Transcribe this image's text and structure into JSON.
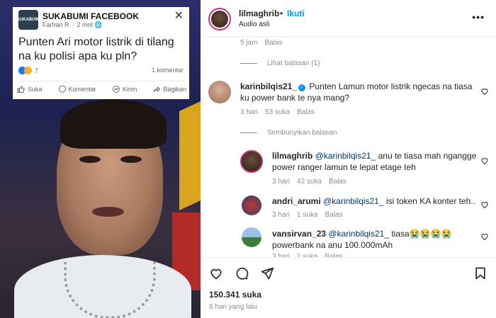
{
  "media": {
    "fb_card": {
      "group_name": "SUKABUMI FACEBOOK",
      "avatar_text": "SUKABUMI",
      "author": "Farhan R",
      "time": "2 mnt",
      "post_text": "Punten Ari motor listrik di tilang na ku polisi apa ku pln?",
      "reaction_count": "7",
      "comments": "1 komentar",
      "actions": [
        "Suka",
        "Komentar",
        "Kirim",
        "Bagikan"
      ]
    }
  },
  "header": {
    "username": "lilmaghrib",
    "dot": "•",
    "follow_label": "Ikuti",
    "audio_label": "Audio asli",
    "more_icon": "more-horizontal-icon"
  },
  "comments": {
    "prev_meta": {
      "time": "5 jam",
      "reply": "Balas"
    },
    "view_replies": "Lihat balasan (1)",
    "main_comment": {
      "username": "karinbilqis21_",
      "text": "Punten Lamun motor listrik ngecas na tiasa ku power bank te nya mang?",
      "time": "3 hari",
      "likes": "53 suka",
      "reply": "Balas"
    },
    "hide_replies": "Sembunyikan balasan",
    "replies": [
      {
        "username": "lilmaghrib",
        "mention": "@karinbilqis21_",
        "text": "anu te tiasa mah ngangge power ranger lamun te lepat etage teh",
        "time": "3 hari",
        "likes": "42 suka",
        "reply": "Balas"
      },
      {
        "username": "andri_arumi",
        "mention": "@karinbilqis21_",
        "text": "isi token KA konter teh..",
        "time": "3 hari",
        "likes": "1 suka",
        "reply": "Balas"
      },
      {
        "username": "vansirvan_23",
        "mention": "@karinbilqis21_",
        "text": "tiasa😭😭😭😭 powerbank na anu 100.000mAh",
        "time": "3 hari",
        "likes": "1 suka",
        "reply": "Balas"
      }
    ]
  },
  "footer": {
    "likes": "150.341 suka",
    "time": "6 hari yang lalu"
  }
}
